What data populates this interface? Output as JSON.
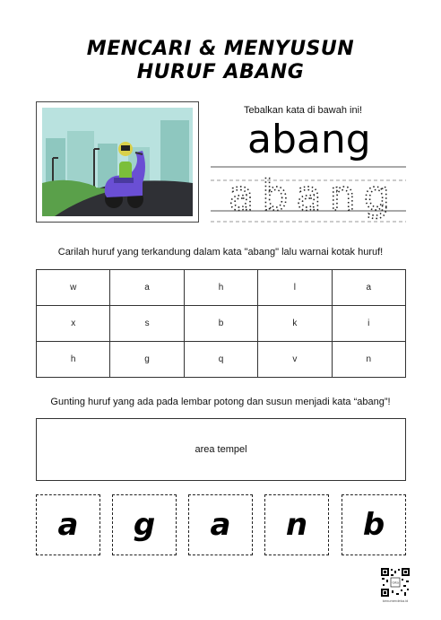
{
  "header": {
    "title_line1": "MENCARI & MENYUSUN",
    "title_line2": "HURUF ABANG"
  },
  "word_section": {
    "instruction": "Tebalkan kata di bawah ini!",
    "word": "abang",
    "trace_word": "abang"
  },
  "grid_section": {
    "instruction": "Carilah huruf yang terkandung dalam kata \"abang\" lalu warnai kotak huruf!",
    "rows": [
      [
        "w",
        "a",
        "h",
        "l",
        "a"
      ],
      [
        "x",
        "s",
        "b",
        "k",
        "i"
      ],
      [
        "h",
        "g",
        "q",
        "v",
        "n"
      ]
    ]
  },
  "cut_section": {
    "instruction": "Gunting huruf yang ada pada lembar potong dan susun menjadi kata “abang”!",
    "paste_area_label": "area tempel",
    "cards": [
      "a",
      "g",
      "a",
      "n",
      "b"
    ]
  },
  "footer": {
    "qr_center_label": "Gita",
    "qr_caption": "kenumerdeka.id"
  },
  "colors": {
    "sky": "#b9e2df",
    "buildings": "#8ec7bf",
    "grass": "#5aa04a",
    "road": "#2f3035",
    "scooter": "#6a4fd4",
    "jacket": "#7bbf3a"
  }
}
